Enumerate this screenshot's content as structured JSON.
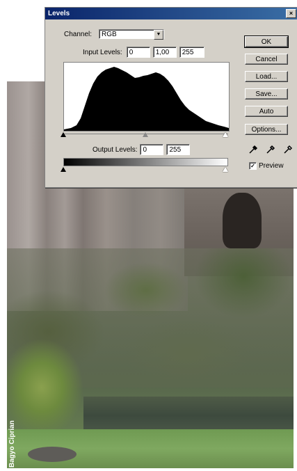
{
  "photo": {
    "credit": "Bagyo Ciprian"
  },
  "dialog": {
    "title": "Levels",
    "close_glyph": "×",
    "channel": {
      "label": "Channel:",
      "value": "RGB"
    },
    "input_levels": {
      "label": "Input Levels:",
      "black": "0",
      "gamma": "1,00",
      "white": "255"
    },
    "output_levels": {
      "label": "Output Levels:",
      "black": "0",
      "white": "255"
    },
    "buttons": {
      "ok": "OK",
      "cancel": "Cancel",
      "load": "Load...",
      "save": "Save...",
      "auto": "Auto",
      "options": "Options..."
    },
    "eyedropper_icons": [
      "black-point-eyedropper-icon",
      "gray-point-eyedropper-icon",
      "white-point-eyedropper-icon"
    ],
    "preview": {
      "label": "Preview",
      "checked": true
    }
  }
}
